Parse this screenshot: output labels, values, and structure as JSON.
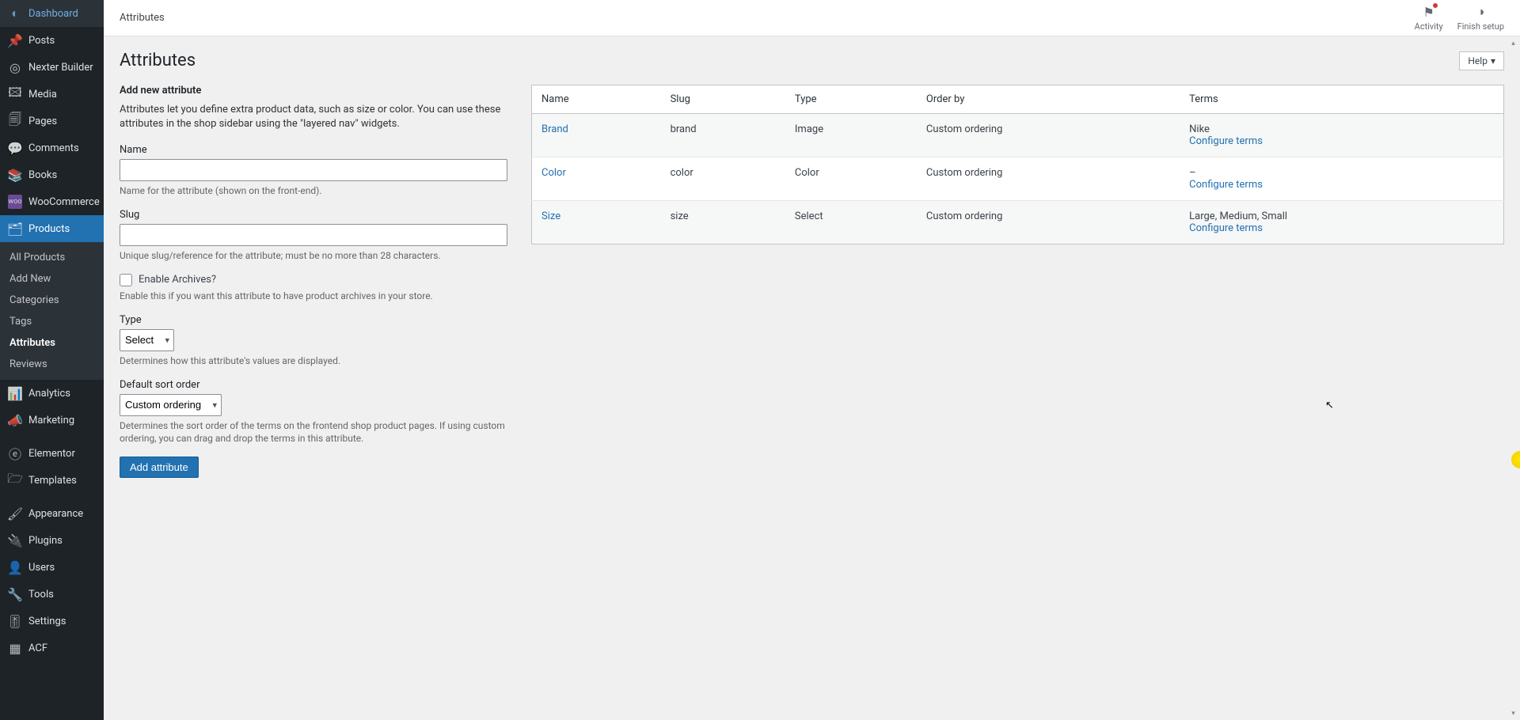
{
  "sidebar": {
    "items": [
      {
        "label": "Dashboard"
      },
      {
        "label": "Posts"
      },
      {
        "label": "Nexter Builder"
      },
      {
        "label": "Media"
      },
      {
        "label": "Pages"
      },
      {
        "label": "Comments"
      },
      {
        "label": "Books"
      },
      {
        "label": "WooCommerce"
      },
      {
        "label": "Products"
      },
      {
        "label": "Analytics"
      },
      {
        "label": "Marketing"
      },
      {
        "label": "Elementor"
      },
      {
        "label": "Templates"
      },
      {
        "label": "Appearance"
      },
      {
        "label": "Plugins"
      },
      {
        "label": "Users"
      },
      {
        "label": "Tools"
      },
      {
        "label": "Settings"
      },
      {
        "label": "ACF"
      }
    ],
    "submenu": [
      {
        "label": "All Products"
      },
      {
        "label": "Add New"
      },
      {
        "label": "Categories"
      },
      {
        "label": "Tags"
      },
      {
        "label": "Attributes"
      },
      {
        "label": "Reviews"
      }
    ]
  },
  "topbar": {
    "breadcrumb": "Attributes",
    "activity": "Activity",
    "finish_setup": "Finish setup"
  },
  "page": {
    "heading": "Attributes",
    "help_label": "Help"
  },
  "form": {
    "title": "Add new attribute",
    "desc": "Attributes let you define extra product data, such as size or color. You can use these attributes in the shop sidebar using the \"layered nav\" widgets.",
    "name_label": "Name",
    "name_value": "",
    "name_help": "Name for the attribute (shown on the front-end).",
    "slug_label": "Slug",
    "slug_value": "",
    "slug_help": "Unique slug/reference for the attribute; must be no more than 28 characters.",
    "archives_label": "Enable Archives?",
    "archives_help": "Enable this if you want this attribute to have product archives in your store.",
    "type_label": "Type",
    "type_value": "Select",
    "type_help": "Determines how this attribute's values are displayed.",
    "sort_label": "Default sort order",
    "sort_value": "Custom ordering",
    "sort_help": "Determines the sort order of the terms on the frontend shop product pages. If using custom ordering, you can drag and drop the terms in this attribute.",
    "submit": "Add attribute"
  },
  "table": {
    "headers": {
      "name": "Name",
      "slug": "Slug",
      "type": "Type",
      "order": "Order by",
      "terms": "Terms"
    },
    "configure": "Configure terms",
    "rows": [
      {
        "name": "Brand",
        "slug": "brand",
        "type": "Image",
        "order": "Custom ordering",
        "terms": "Nike"
      },
      {
        "name": "Color",
        "slug": "color",
        "type": "Color",
        "order": "Custom ordering",
        "terms": "–"
      },
      {
        "name": "Size",
        "slug": "size",
        "type": "Select",
        "order": "Custom ordering",
        "terms": "Large, Medium, Small"
      }
    ]
  }
}
